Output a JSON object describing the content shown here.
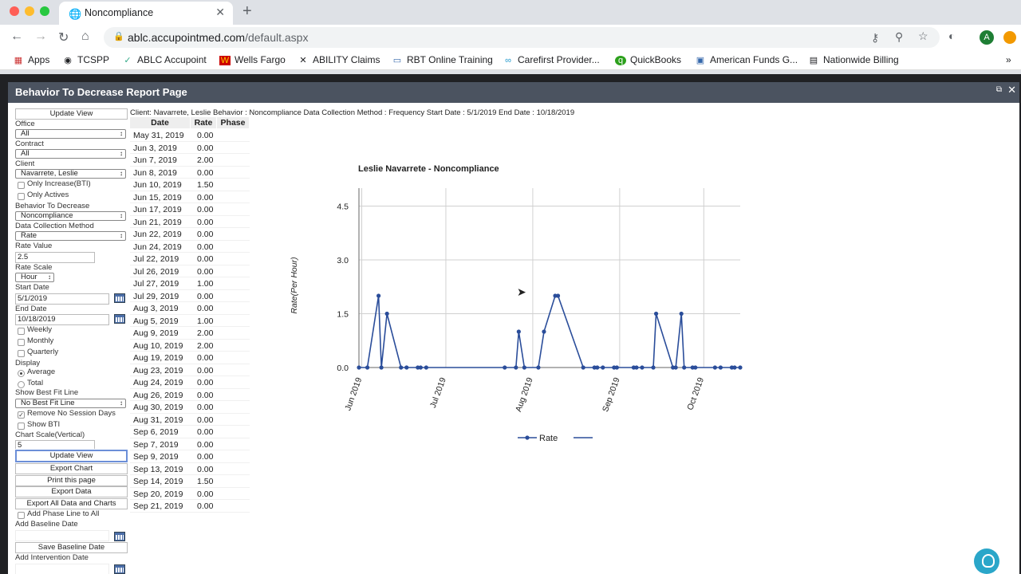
{
  "browser": {
    "tab_title": "Noncompliance",
    "url_domain": "ablc.accupointmed.com",
    "url_path": "/default.aspx",
    "avatar_letter": "A",
    "bookmarks": [
      "Apps",
      "TCSPP",
      "ABLC Accupoint",
      "Wells Fargo",
      "ABILITY Claims",
      "RBT Online Training",
      "Carefirst Provider...",
      "QuickBooks",
      "American Funds G...",
      "Nationwide Billing"
    ],
    "bookmarks_overflow": "»"
  },
  "app": {
    "title": "Behavior To Decrease Report Page"
  },
  "form": {
    "update_view": "Update View",
    "office_label": "Office",
    "office_value": "All",
    "contract_label": "Contract",
    "contract_value": "All",
    "client_label": "Client",
    "client_value": "Navarrete, Leslie",
    "only_increase": "Only Increase(BTI)",
    "only_actives": "Only Actives",
    "behavior_label": "Behavior To Decrease",
    "behavior_value": "Noncompliance",
    "method_label": "Data Collection Method",
    "method_value": "Rate",
    "rate_value_label": "Rate Value",
    "rate_value": "2.5",
    "rate_scale_label": "Rate Scale",
    "rate_scale_value": "Hour",
    "start_date_label": "Start Date",
    "start_date": "5/1/2019",
    "end_date_label": "End Date",
    "end_date": "10/18/2019",
    "weekly": "Weekly",
    "monthly": "Monthly",
    "quarterly": "Quarterly",
    "display_label": "Display",
    "average": "Average",
    "total": "Total",
    "best_fit_label": "Show Best Fit Line",
    "best_fit_value": "No Best Fit Line",
    "remove_no_session": "Remove No Session Days",
    "show_bti": "Show BTI",
    "chart_scale_label": "Chart Scale(Vertical)",
    "chart_scale_value": "5",
    "update_view_2": "Update View",
    "export_chart": "Export Chart",
    "print_page": "Print this page",
    "export_data": "Export Data",
    "export_all": "Export All Data and Charts",
    "add_phase_line": "Add Phase Line to All",
    "add_baseline_label": "Add Baseline Date",
    "save_baseline": "Save Baseline Date",
    "add_intervention_label": "Add Intervention Date"
  },
  "info_line": "Client: Navarrete, Leslie Behavior : Noncompliance Data Collection Method : Frequency Start Date : 5/1/2019 End Date : 10/18/2019",
  "table": {
    "headers": [
      "Date",
      "Rate",
      "Phase"
    ],
    "rows": [
      [
        "May 31, 2019",
        "0.00"
      ],
      [
        "Jun 3, 2019",
        "0.00"
      ],
      [
        "Jun 7, 2019",
        "2.00"
      ],
      [
        "Jun 8, 2019",
        "0.00"
      ],
      [
        "Jun 10, 2019",
        "1.50"
      ],
      [
        "Jun 15, 2019",
        "0.00"
      ],
      [
        "Jun 17, 2019",
        "0.00"
      ],
      [
        "Jun 21, 2019",
        "0.00"
      ],
      [
        "Jun 22, 2019",
        "0.00"
      ],
      [
        "Jun 24, 2019",
        "0.00"
      ],
      [
        "Jul 22, 2019",
        "0.00"
      ],
      [
        "Jul 26, 2019",
        "0.00"
      ],
      [
        "Jul 27, 2019",
        "1.00"
      ],
      [
        "Jul 29, 2019",
        "0.00"
      ],
      [
        "Aug 3, 2019",
        "0.00"
      ],
      [
        "Aug 5, 2019",
        "1.00"
      ],
      [
        "Aug 9, 2019",
        "2.00"
      ],
      [
        "Aug 10, 2019",
        "2.00"
      ],
      [
        "Aug 19, 2019",
        "0.00"
      ],
      [
        "Aug 23, 2019",
        "0.00"
      ],
      [
        "Aug 24, 2019",
        "0.00"
      ],
      [
        "Aug 26, 2019",
        "0.00"
      ],
      [
        "Aug 30, 2019",
        "0.00"
      ],
      [
        "Aug 31, 2019",
        "0.00"
      ],
      [
        "Sep 6, 2019",
        "0.00"
      ],
      [
        "Sep 7, 2019",
        "0.00"
      ],
      [
        "Sep 9, 2019",
        "0.00"
      ],
      [
        "Sep 13, 2019",
        "0.00"
      ],
      [
        "Sep 14, 2019",
        "1.50"
      ],
      [
        "Sep 20, 2019",
        "0.00"
      ],
      [
        "Sep 21, 2019",
        "0.00"
      ]
    ]
  },
  "chart_data": {
    "type": "line",
    "title": "Leslie Navarrete - Noncompliance",
    "ylabel": "Rate(Per Hour)",
    "xlabel": "",
    "ylim": [
      0,
      5
    ],
    "yticks": [
      "0.0",
      "1.5",
      "3.0",
      "4.5"
    ],
    "xticks": [
      "Jun 2019",
      "Jul 2019",
      "Aug 2019",
      "Sep 2019",
      "Oct 2019"
    ],
    "grid": true,
    "legend": [
      "Rate"
    ],
    "legend_position": "bottom",
    "series": [
      {
        "name": "Rate",
        "color": "#2a4d9a",
        "points": [
          [
            "2019-05-31",
            0
          ],
          [
            "2019-06-03",
            0
          ],
          [
            "2019-06-07",
            2
          ],
          [
            "2019-06-08",
            0
          ],
          [
            "2019-06-10",
            1.5
          ],
          [
            "2019-06-15",
            0
          ],
          [
            "2019-06-17",
            0
          ],
          [
            "2019-06-21",
            0
          ],
          [
            "2019-06-22",
            0
          ],
          [
            "2019-06-24",
            0
          ],
          [
            "2019-07-22",
            0
          ],
          [
            "2019-07-26",
            0
          ],
          [
            "2019-07-27",
            1
          ],
          [
            "2019-07-29",
            0
          ],
          [
            "2019-08-03",
            0
          ],
          [
            "2019-08-05",
            1
          ],
          [
            "2019-08-09",
            2
          ],
          [
            "2019-08-10",
            2
          ],
          [
            "2019-08-19",
            0
          ],
          [
            "2019-08-23",
            0
          ],
          [
            "2019-08-24",
            0
          ],
          [
            "2019-08-26",
            0
          ],
          [
            "2019-08-30",
            0
          ],
          [
            "2019-08-31",
            0
          ],
          [
            "2019-09-06",
            0
          ],
          [
            "2019-09-07",
            0
          ],
          [
            "2019-09-09",
            0
          ],
          [
            "2019-09-13",
            0
          ],
          [
            "2019-09-14",
            1.5
          ],
          [
            "2019-09-20",
            0
          ],
          [
            "2019-09-21",
            0
          ],
          [
            "2019-09-23",
            1.5
          ],
          [
            "2019-09-24",
            0
          ],
          [
            "2019-09-27",
            0
          ],
          [
            "2019-09-28",
            0
          ],
          [
            "2019-10-05",
            0
          ],
          [
            "2019-10-07",
            0
          ],
          [
            "2019-10-11",
            0
          ],
          [
            "2019-10-12",
            0
          ],
          [
            "2019-10-14",
            0
          ]
        ]
      }
    ]
  },
  "colors": {
    "header_bar": "#4b5360",
    "series": "#2a4d9a",
    "help": "#2aa6c9"
  }
}
